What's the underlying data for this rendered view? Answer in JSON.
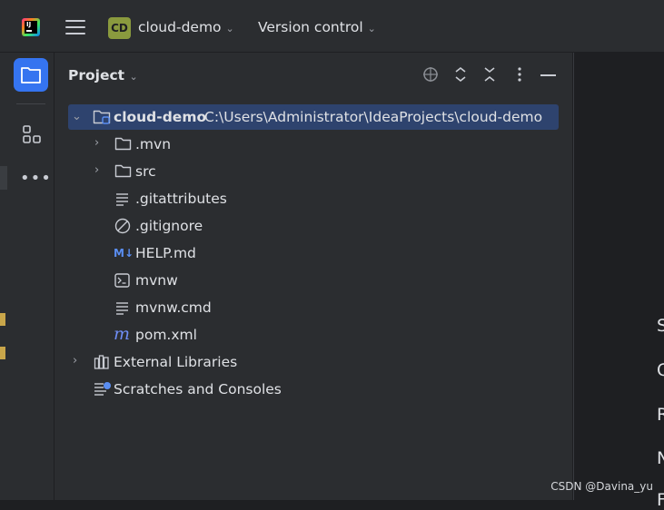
{
  "titlebar": {
    "logo_letters": "IJ",
    "project_badge": "CD",
    "project_name": "cloud-demo",
    "vcs_menu": "Version control"
  },
  "stripe": {
    "items": [
      {
        "icon": "folder-icon",
        "active": true
      },
      {
        "icon": "structure-icon",
        "active": false
      },
      {
        "icon": "more-dots-icon",
        "active": false
      }
    ],
    "more_glyph": "•••"
  },
  "panel": {
    "title": "Project",
    "tools": [
      "locate-icon",
      "expand-all-icon",
      "collapse-all-icon",
      "options-icon",
      "hide-icon"
    ]
  },
  "tree": {
    "root": {
      "name": "cloud-demo",
      "path": "C:\\Users\\Administrator\\IdeaProjects\\cloud-demo"
    },
    "children": [
      {
        "name": ".mvn",
        "icon": "folder-icon",
        "expandable": true
      },
      {
        "name": "src",
        "icon": "folder-icon",
        "expandable": true
      },
      {
        "name": ".gitattributes",
        "icon": "text-file-icon",
        "expandable": false
      },
      {
        "name": ".gitignore",
        "icon": "ignore-file-icon",
        "expandable": false
      },
      {
        "name": "HELP.md",
        "icon": "markdown-icon",
        "expandable": false
      },
      {
        "name": "mvnw",
        "icon": "shell-script-icon",
        "expandable": false
      },
      {
        "name": "mvnw.cmd",
        "icon": "text-file-icon",
        "expandable": false
      },
      {
        "name": "pom.xml",
        "icon": "maven-icon",
        "expandable": false
      }
    ],
    "external_libraries": "External Libraries",
    "scratches": "Scratches and Consoles"
  },
  "editor": {
    "letters": [
      "S",
      "C",
      "R",
      "N",
      "F"
    ]
  },
  "watermark": "CSDN @Davina_yu",
  "colors": {
    "background": "#1e1f22",
    "panel": "#2b2d30",
    "selection": "#2e436e",
    "accent": "#3574f0",
    "badge": "#8a9a3e"
  }
}
